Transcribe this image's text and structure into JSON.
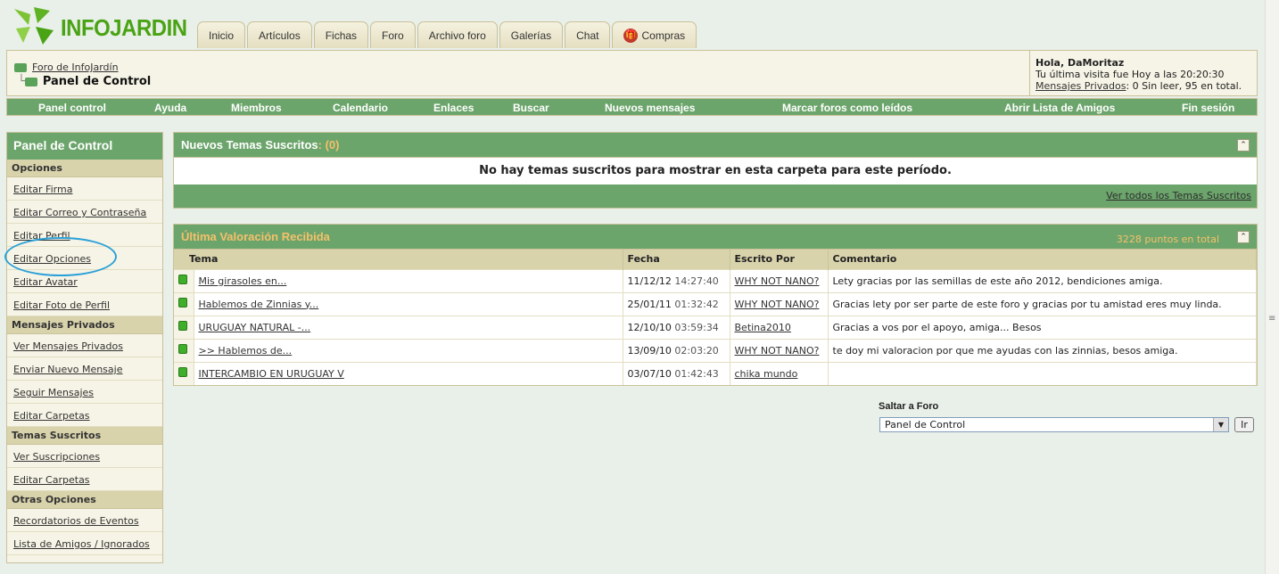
{
  "logo": {
    "text": "INFOJARDIN"
  },
  "tabs": [
    {
      "label": "Inicio"
    },
    {
      "label": "Artículos"
    },
    {
      "label": "Fichas"
    },
    {
      "label": "Foro"
    },
    {
      "label": "Archivo foro"
    },
    {
      "label": "Galerías"
    },
    {
      "label": "Chat"
    },
    {
      "label": "Compras"
    }
  ],
  "breadcrumb": {
    "parent": "Foro de InfoJardín",
    "current": "Panel de Control"
  },
  "user": {
    "greeting": "Hola, DaMoritaz",
    "last_visit": "Tu última visita fue Hoy a las 20:20:30",
    "pm_link": "Mensajes Privados",
    "pm_status": ": 0 Sin leer, 95 en total."
  },
  "navbar": [
    "Panel control",
    "Ayuda",
    "Miembros",
    "Calendario",
    "Enlaces",
    "Buscar",
    "Nuevos mensajes",
    "Marcar foros como leídos",
    "Abrir Lista de Amigos",
    "Fin sesión"
  ],
  "sidebar": {
    "title": "Panel de Control",
    "sections": [
      {
        "title": "Opciones",
        "items": [
          "Editar Firma",
          "Editar Correo y Contraseña",
          "Editar Perfil",
          "Editar Opciones",
          "Editar Avatar",
          "Editar Foto de Perfil"
        ]
      },
      {
        "title": "Mensajes Privados",
        "items": [
          "Ver Mensajes Privados",
          "Enviar Nuevo Mensaje",
          "Seguir Mensajes",
          "Editar Carpetas"
        ]
      },
      {
        "title": "Temas Suscritos",
        "items": [
          "Ver Suscripciones",
          "Editar Carpetas"
        ]
      },
      {
        "title": "Otras Opciones",
        "items": [
          "Recordatorios de Eventos",
          "Lista de Amigos / Ignorados"
        ]
      }
    ]
  },
  "subscribed": {
    "title": "Nuevos Temas Suscritos",
    "count": ": (0)",
    "empty": "No hay temas suscritos para mostrar en esta carpeta para este período.",
    "view_all": "Ver todos los Temas Suscritos"
  },
  "rating": {
    "title": "Última Valoración Recibida",
    "points": "3228 puntos en total",
    "headers": [
      "Tema",
      "Fecha",
      "Escrito Por",
      "Comentario"
    ],
    "rows": [
      {
        "topic": "Mis girasoles en...",
        "date": "11/12/12",
        "time": "14:27:40",
        "author": "WHY NOT NANO?",
        "comment": "Lety gracias por las semillas de este año 2012, bendiciones amiga."
      },
      {
        "topic": "Hablemos de Zinnias y...",
        "date": "25/01/11",
        "time": "01:32:42",
        "author": "WHY NOT NANO?",
        "comment": "Gracias lety por ser parte de este foro y gracias por tu amistad eres muy linda."
      },
      {
        "topic": "URUGUAY NATURAL -...",
        "date": "12/10/10",
        "time": "03:59:34",
        "author": "Betina2010",
        "comment": "Gracias a vos por el apoyo, amiga... Besos"
      },
      {
        "topic": ">> Hablemos de...",
        "date": "13/09/10",
        "time": "02:03:20",
        "author": "WHY NOT NANO?",
        "comment": "te doy mi valoracion por que me ayudas con las zinnias, besos amiga."
      },
      {
        "topic": "INTERCAMBIO EN URUGUAY V",
        "date": "03/07/10",
        "time": "01:42:43",
        "author": "chika mundo",
        "comment": ""
      }
    ]
  },
  "jump": {
    "label": "Saltar a Foro",
    "selected": "Panel de Control",
    "button": "Ir"
  },
  "colors": {
    "green": "#6ca56c",
    "beige": "#f6f4e6",
    "section": "#d9d3ac",
    "accent": "#f5c06a",
    "logo": "#4aa314",
    "annotation": "#2aa0d8"
  },
  "icons": [
    "leaf-logo-icon",
    "gift-icon",
    "folder-icon",
    "collapse-icon",
    "status-dot-icon",
    "dropdown-arrow-icon"
  ]
}
